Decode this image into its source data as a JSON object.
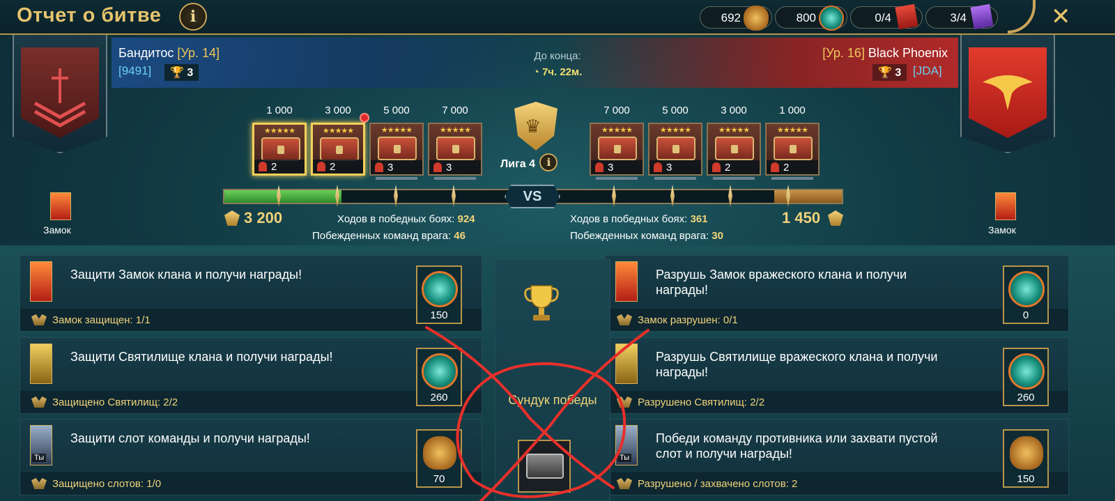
{
  "header": {
    "title": "Отчет о битве",
    "info_icon": "i",
    "resources": [
      {
        "value": "692",
        "icon": "gold-bag-icon"
      },
      {
        "value": "800",
        "icon": "teal-orb-icon"
      },
      {
        "value": "0/4",
        "icon": "red-scroll-icon"
      },
      {
        "value": "3/4",
        "icon": "purple-scroll-icon"
      }
    ],
    "close_icon": "✕"
  },
  "left_player": {
    "name": "Бандитос",
    "level": "[Ур. 14]",
    "tag": "[9491]",
    "trophies": "3",
    "castle_label": "Замок",
    "score": "3 200",
    "win_moves_label": "Ходов в победных боях:",
    "win_moves": "924",
    "defeated_label": "Побежденных команд врага:",
    "defeated": "46"
  },
  "right_player": {
    "name": "Black Phoenix",
    "level": "[Ур. 16]",
    "tag": "[JDA]",
    "trophies": "3",
    "castle_label": "Замок",
    "score": "1 450",
    "win_moves_label": "Ходов в победных боях:",
    "win_moves": "361",
    "defeated_label": "Побежденных команд врага:",
    "defeated": "30"
  },
  "timer": {
    "label": "До конца:",
    "value": "7ч. 22м."
  },
  "league": {
    "label": "Лига 4",
    "info": "i"
  },
  "vs_label": "VS",
  "progress": {
    "left_fill": 0.19,
    "right_fill": 0.11
  },
  "chests_left": [
    {
      "amount": "1 000",
      "count": "2",
      "active": true
    },
    {
      "amount": "3 000",
      "count": "2",
      "active": true
    },
    {
      "amount": "5 000",
      "count": "3",
      "active": false
    },
    {
      "amount": "7 000",
      "count": "3",
      "active": false
    }
  ],
  "chests_right": [
    {
      "amount": "7 000",
      "count": "3"
    },
    {
      "amount": "5 000",
      "count": "3"
    },
    {
      "amount": "3 000",
      "count": "2"
    },
    {
      "amount": "1 000",
      "count": "2"
    }
  ],
  "chest_stars": "★★★★★",
  "missions_left": [
    {
      "text": "Защити Замок клана и получи награды!",
      "status": "Замок защищен: 1/1",
      "reward": "150",
      "reward_icon": "teal-orb-icon"
    },
    {
      "text": "Защити Святилище клана и получи награды!",
      "status": "Защищено Святилищ: 2/2",
      "reward": "260",
      "reward_icon": "teal-orb-icon"
    },
    {
      "text": "Защити слот команды и получи награды!",
      "status": "Защищено слотов: 1/0",
      "reward": "70",
      "reward_icon": "gold-bag-icon",
      "avatar_label": "Ты"
    }
  ],
  "missions_right": [
    {
      "text": "Разрушь Замок вражеского клана и получи награды!",
      "status": "Замок разрушен: 0/1",
      "reward": "0",
      "reward_icon": "teal-orb-icon"
    },
    {
      "text": "Разрушь Святилище вражеского клана и получи награды!",
      "status": "Разрушено Святилищ: 2/2",
      "reward": "260",
      "reward_icon": "teal-orb-icon"
    },
    {
      "text": "Победи команду противника или захвати пустой слот и получи награды!",
      "status": "Разрушено / захвачено слотов: 2",
      "reward": "150",
      "reward_icon": "gold-bag-icon",
      "avatar_label": "Ты"
    }
  ],
  "victory_chest": {
    "label": "Сундук победы"
  },
  "colors": {
    "gold": "#f2d37a",
    "red_annotation": "#e8302a",
    "left_blue": "#1b4a82",
    "right_red": "#b02a2a"
  }
}
